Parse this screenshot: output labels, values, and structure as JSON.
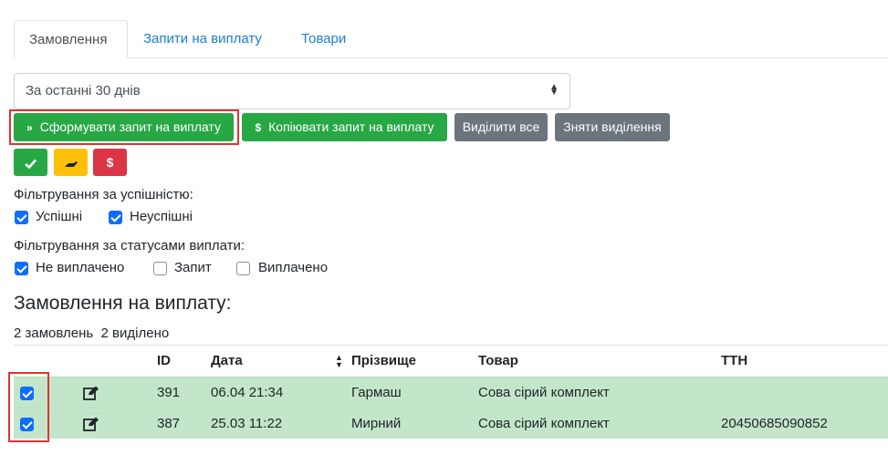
{
  "tabs": [
    {
      "label": "Замовлення"
    },
    {
      "label": "Запити на виплату"
    },
    {
      "label": "Товари"
    }
  ],
  "period_select": {
    "value": "За останні 30 днів"
  },
  "actions": {
    "form_request": "Сформувати запит на виплату",
    "copy_request": "Копіювати запит на виплату",
    "select_all": "Виділити все",
    "unselect": "Зняти виділення"
  },
  "quick_actions": [
    {
      "icon": "check-icon",
      "symbol": "✔",
      "color": "#28a745"
    },
    {
      "icon": "hand-icon",
      "symbol": "✋",
      "color": "#ffc107"
    },
    {
      "icon": "dollar-icon",
      "symbol": "$",
      "color": "#dc3545"
    }
  ],
  "filter_success": {
    "label": "Фільтрування за успішністю:",
    "options": [
      {
        "label": "Успішні",
        "checked": true
      },
      {
        "label": "Неуспішні",
        "checked": true
      }
    ]
  },
  "filter_status": {
    "label": "Фільтрування за статусами виплати:",
    "options": [
      {
        "label": "Не виплачено",
        "checked": true
      },
      {
        "label": "Запит",
        "checked": false
      },
      {
        "label": "Виплачено",
        "checked": false
      }
    ]
  },
  "orders": {
    "title": "Замовлення на виплату:",
    "counts": "2 замовлень  2 виділено",
    "columns": [
      "ID",
      "Дата",
      "Прізвище",
      "Товар",
      "ТТН"
    ],
    "rows": [
      {
        "checked": true,
        "id": "391",
        "date": "06.04 21:34",
        "surname": "Гармаш",
        "product": "Сова сірий комплект",
        "ttn": ""
      },
      {
        "checked": true,
        "id": "387",
        "date": "25.03 11:22",
        "surname": "Мирний",
        "product": "Сова сірий комплект",
        "ttn": "20450685090852"
      }
    ]
  },
  "colors": {
    "accent": "#28a745",
    "row_bg": "#c3e6cb",
    "highlight": "#e0342f",
    "link": "#1a7fd4"
  }
}
